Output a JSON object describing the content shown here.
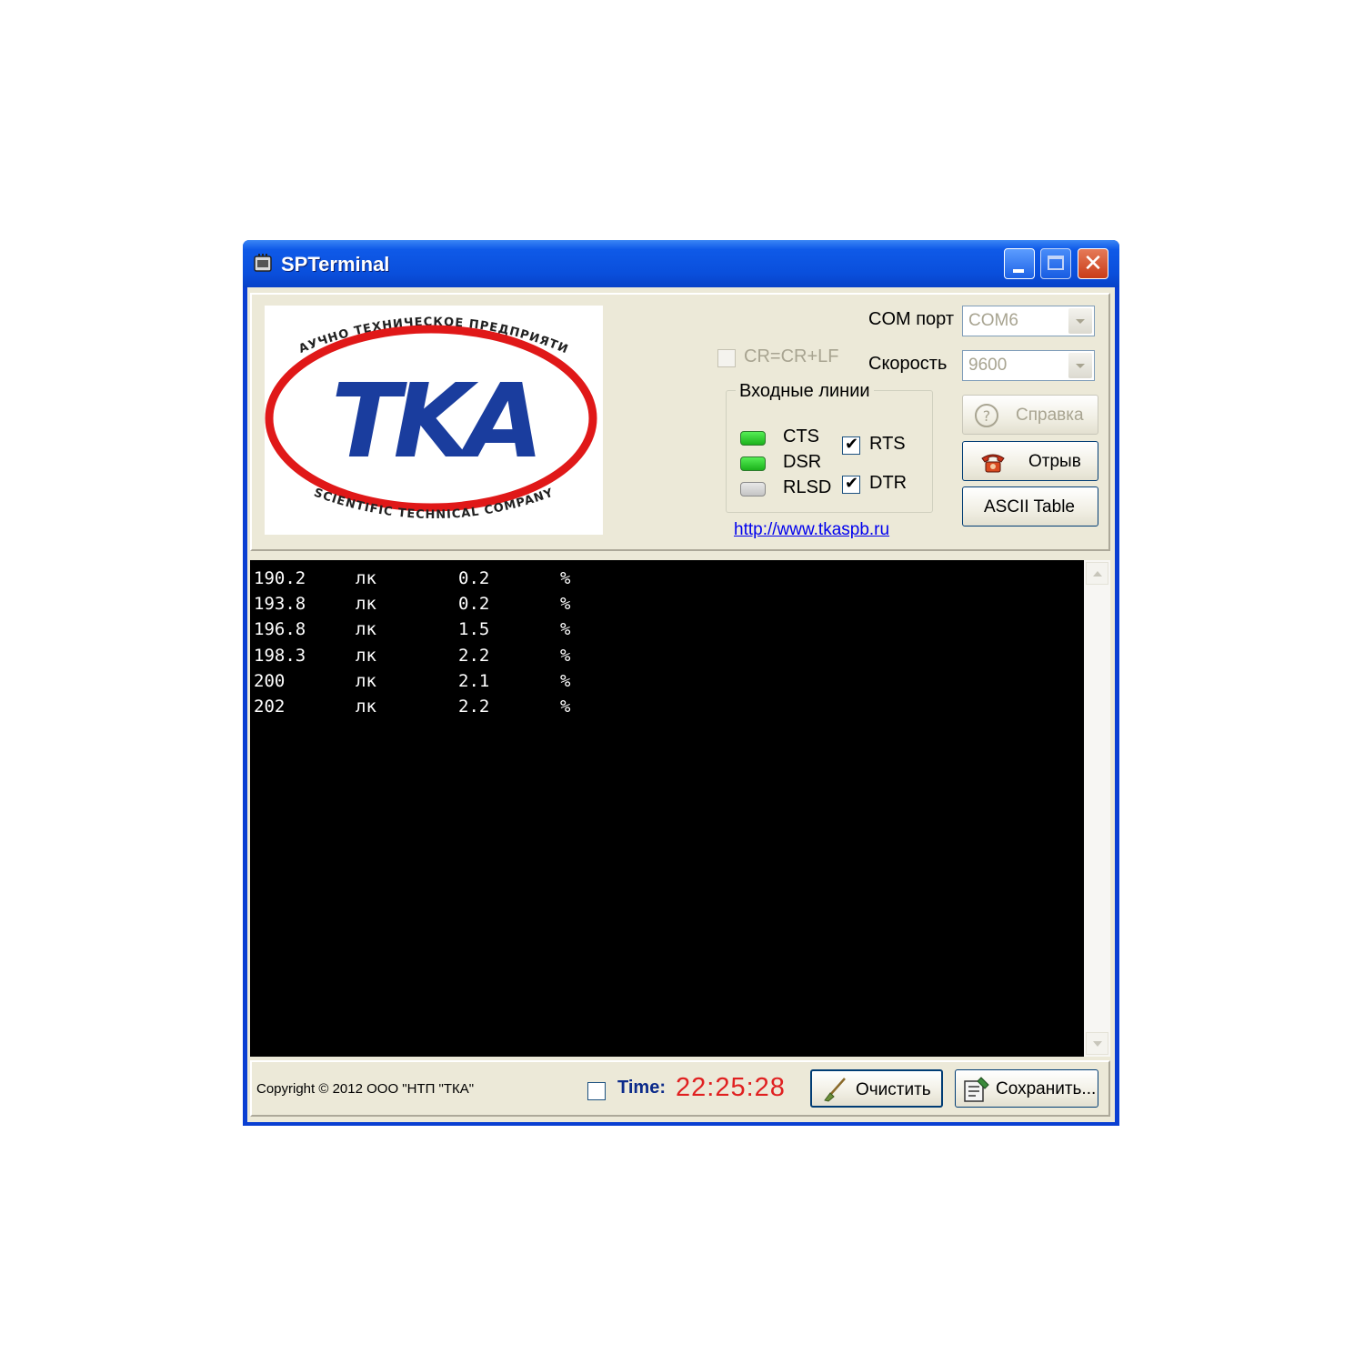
{
  "window": {
    "title": "SPTerminal"
  },
  "logo": {
    "text": "TKA",
    "arc_top": "НАУЧНО ТЕХНИЧЕСКОЕ ПРЕДПРИЯТИЕ",
    "arc_bottom": "SCIENTIFIC TECHNICAL COMPANY",
    "colors": {
      "ellipse": "#e01818",
      "letters": "#1a3d9e"
    }
  },
  "settings": {
    "com_port_label": "COM порт",
    "com_port_value": "COM6",
    "speed_label": "Скорость",
    "speed_value": "9600",
    "crlf_label": "CR=CR+LF",
    "crlf_checked": false
  },
  "input_lines": {
    "title": "Входные линии",
    "leds": [
      {
        "label": "CTS",
        "state": "on"
      },
      {
        "label": "DSR",
        "state": "on"
      },
      {
        "label": "RLSD",
        "state": "off"
      }
    ],
    "outputs": [
      {
        "label": "RTS",
        "checked": true
      },
      {
        "label": "DTR",
        "checked": true
      }
    ]
  },
  "link": "http://www.tkaspb.ru",
  "buttons": {
    "help": "Справка",
    "disconnect": "Отрыв",
    "ascii_table": "ASCII Table",
    "clear": "Очистить",
    "save": "Сохранить..."
  },
  "terminal": {
    "rows": [
      [
        "190.2",
        "лк",
        "0.2",
        "%"
      ],
      [
        "193.8",
        "лк",
        "0.2",
        "%"
      ],
      [
        "196.8",
        "лк",
        "1.5",
        "%"
      ],
      [
        "198.3",
        "лк",
        "2.2",
        "%"
      ],
      [
        "200",
        "лк",
        "2.1",
        "%"
      ],
      [
        "202",
        "лк",
        "2.2",
        "%"
      ]
    ]
  },
  "footer": {
    "copyright": "Copyright © 2012 ООО \"НТП \"ТКА\"",
    "time_label": "Time:",
    "time_value": "22:25:28",
    "time_checked": false
  },
  "colors": {
    "titlebar": "#0a4fdc",
    "time_value": "#e02020",
    "led_on": "#2fd12f",
    "terminal_bg": "#000000"
  }
}
